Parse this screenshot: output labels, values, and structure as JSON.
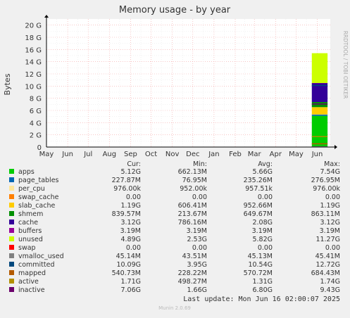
{
  "chart_data": {
    "type": "area",
    "title": "Memory usage - by year",
    "ylabel": "Bytes",
    "side_label": "RRDTOOL / TOBI OETIKER",
    "ylim": [
      0,
      21
    ],
    "yticks": [
      {
        "value": 0,
        "label": "0"
      },
      {
        "value": 2,
        "label": "2 G"
      },
      {
        "value": 4,
        "label": "4 G"
      },
      {
        "value": 6,
        "label": "6 G"
      },
      {
        "value": 8,
        "label": "8 G"
      },
      {
        "value": 10,
        "label": "10 G"
      },
      {
        "value": 12,
        "label": "12 G"
      },
      {
        "value": 14,
        "label": "14 G"
      },
      {
        "value": 16,
        "label": "16 G"
      },
      {
        "value": 18,
        "label": "18 G"
      },
      {
        "value": 20,
        "label": "20 G"
      }
    ],
    "x_range": [
      "2024-05-01",
      "2025-06-20"
    ],
    "xticks": [
      {
        "date": "2024-05-01",
        "label": "May"
      },
      {
        "date": "2024-06-01",
        "label": "Jun"
      },
      {
        "date": "2024-07-01",
        "label": "Jul"
      },
      {
        "date": "2024-08-01",
        "label": "Aug"
      },
      {
        "date": "2024-09-01",
        "label": "Sep"
      },
      {
        "date": "2024-10-01",
        "label": "Oct"
      },
      {
        "date": "2024-11-01",
        "label": "Nov"
      },
      {
        "date": "2024-12-01",
        "label": "Dec"
      },
      {
        "date": "2025-01-01",
        "label": "Jan"
      },
      {
        "date": "2025-02-01",
        "label": "Feb"
      },
      {
        "date": "2025-03-01",
        "label": "Mar"
      },
      {
        "date": "2025-04-01",
        "label": "Apr"
      },
      {
        "date": "2025-05-01",
        "label": "May"
      },
      {
        "date": "2025-06-01",
        "label": "Jun"
      }
    ],
    "data_period": [
      "2025-05-24",
      "2025-06-16"
    ],
    "stack": [
      {
        "name": "apps",
        "color": "#00cc00",
        "value": 5.12
      },
      {
        "name": "page_tables",
        "color": "#0066b3",
        "value": 0.23
      },
      {
        "name": "per_cpu",
        "color": "#ffe699",
        "value": 0.001
      },
      {
        "name": "swap_cache",
        "color": "#ff8000",
        "value": 0.0
      },
      {
        "name": "slab_cache",
        "color": "#ffcc00",
        "value": 1.19
      },
      {
        "name": "shmem",
        "color": "#008f00",
        "value": 0.84
      },
      {
        "name": "cache",
        "color": "#330099",
        "value": 3.12
      },
      {
        "name": "buffers",
        "color": "#990099",
        "value": 0.003
      },
      {
        "name": "unused",
        "color": "#ccff00",
        "value": 4.89
      },
      {
        "name": "swap",
        "color": "#ff0000",
        "value": 0.0
      }
    ],
    "lines": [
      {
        "name": "vmalloc_used",
        "color": "#808080",
        "value": 0.045
      },
      {
        "name": "committed",
        "color": "#00487d",
        "value": 10.09
      },
      {
        "name": "mapped",
        "color": "#b35a00",
        "value": 0.54
      },
      {
        "name": "active",
        "color": "#b38f00",
        "value": 1.71
      },
      {
        "name": "inactive",
        "color": "#6b006b",
        "value": 7.06
      }
    ]
  },
  "legend": {
    "headers": {
      "cur": "Cur:",
      "min": "Min:",
      "avg": "Avg:",
      "max": "Max:"
    },
    "rows": [
      {
        "name": "apps",
        "color": "#00cc00",
        "cur": "5.12G",
        "min": "662.13M",
        "avg": "5.66G",
        "max": "7.54G"
      },
      {
        "name": "page_tables",
        "color": "#0066b3",
        "cur": "227.87M",
        "min": "76.95M",
        "avg": "235.26M",
        "max": "276.95M"
      },
      {
        "name": "per_cpu",
        "color": "#ffe699",
        "cur": "976.00k",
        "min": "952.00k",
        "avg": "957.51k",
        "max": "976.00k"
      },
      {
        "name": "swap_cache",
        "color": "#ff8000",
        "cur": "0.00",
        "min": "0.00",
        "avg": "0.00",
        "max": "0.00"
      },
      {
        "name": "slab_cache",
        "color": "#ffcc00",
        "cur": "1.19G",
        "min": "606.41M",
        "avg": "952.66M",
        "max": "1.19G"
      },
      {
        "name": "shmem",
        "color": "#008f00",
        "cur": "839.57M",
        "min": "213.67M",
        "avg": "649.67M",
        "max": "863.11M"
      },
      {
        "name": "cache",
        "color": "#330099",
        "cur": "3.12G",
        "min": "786.16M",
        "avg": "2.08G",
        "max": "3.12G"
      },
      {
        "name": "buffers",
        "color": "#990099",
        "cur": "3.19M",
        "min": "3.19M",
        "avg": "3.19M",
        "max": "3.19M"
      },
      {
        "name": "unused",
        "color": "#ccff00",
        "cur": "4.89G",
        "min": "2.53G",
        "avg": "5.82G",
        "max": "11.27G"
      },
      {
        "name": "swap",
        "color": "#ff0000",
        "cur": "0.00",
        "min": "0.00",
        "avg": "0.00",
        "max": "0.00"
      },
      {
        "name": "vmalloc_used",
        "color": "#808080",
        "cur": "45.14M",
        "min": "43.51M",
        "avg": "45.13M",
        "max": "45.41M"
      },
      {
        "name": "committed",
        "color": "#00487d",
        "cur": "10.09G",
        "min": "3.95G",
        "avg": "10.54G",
        "max": "12.72G"
      },
      {
        "name": "mapped",
        "color": "#b35a00",
        "cur": "540.73M",
        "min": "228.22M",
        "avg": "570.72M",
        "max": "684.43M"
      },
      {
        "name": "active",
        "color": "#b38f00",
        "cur": "1.71G",
        "min": "498.27M",
        "avg": "1.31G",
        "max": "1.74G"
      },
      {
        "name": "inactive",
        "color": "#6b006b",
        "cur": "7.06G",
        "min": "1.66G",
        "avg": "6.80G",
        "max": "9.43G"
      }
    ]
  },
  "last_update": "Last update: Mon Jun 16 02:00:07 2025",
  "footer": "Munin 2.0.69"
}
